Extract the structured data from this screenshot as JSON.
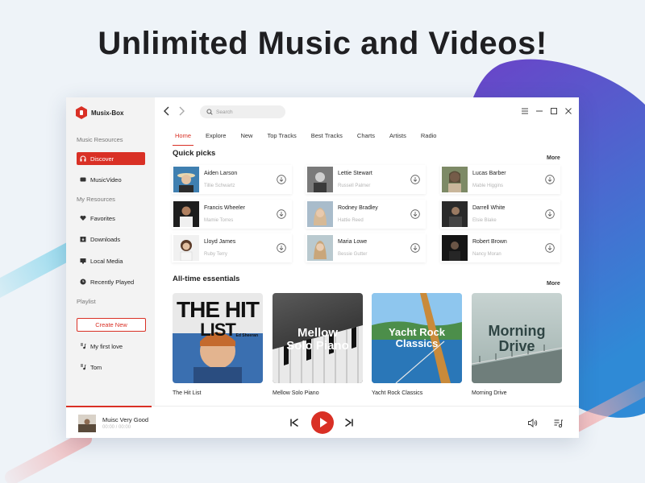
{
  "headline": "Unlimited Music and Videos!",
  "app": {
    "name": "Musix-Box"
  },
  "colors": {
    "accent": "#d93025",
    "blob_top": "#6e3fc7",
    "blob_bottom": "#2f7fd0"
  },
  "sidebar": {
    "music_resources_title": "Music Resources",
    "discover": "Discover",
    "music_video": "MusicVideo",
    "my_resources_title": "My Resources",
    "favorites": "Favorites",
    "downloads": "Downloads",
    "local_media": "Local Media",
    "recently_played": "Recently Played",
    "playlist_title": "Playlist",
    "create_new": "Create New",
    "playlists": [
      "My first love",
      "Tom"
    ]
  },
  "search": {
    "placeholder": "Search"
  },
  "tabs": [
    "Home",
    "Explore",
    "New",
    "Top Tracks",
    "Best Tracks",
    "Charts",
    "Artists",
    "Radio"
  ],
  "quick_picks": {
    "title": "Quick picks",
    "more": "More",
    "items": [
      {
        "title": "Aiden Larson",
        "subtitle": "Tillie Schwartz"
      },
      {
        "title": "Lettie Stewart",
        "subtitle": "Russell Palmer"
      },
      {
        "title": "Lucas Barber",
        "subtitle": "Mable Higgins"
      },
      {
        "title": "Francis Wheeler",
        "subtitle": "Mamie Torres"
      },
      {
        "title": "Rodney Bradley",
        "subtitle": "Hattie Reed"
      },
      {
        "title": "Darrell White",
        "subtitle": "Elsie Blake"
      },
      {
        "title": "Lloyd James",
        "subtitle": "Ruby Terry"
      },
      {
        "title": "Maria Lowe",
        "subtitle": "Bessie Gutter"
      },
      {
        "title": "Robert Brown",
        "subtitle": "Nancy Moran"
      }
    ]
  },
  "essentials": {
    "title": "All-time essentials",
    "more": "More",
    "items": [
      {
        "label": "The Hit List",
        "art_line1": "THE HIT",
        "art_line2": "LIST",
        "art_artist": "Ed Sheeran"
      },
      {
        "label": "Mellow Solo Piano",
        "art_line1": "Mellow",
        "art_line2": "Solo Piano"
      },
      {
        "label": "Yacht Rock Classics",
        "art_line1": "Yacht Rock",
        "art_line2": "Classics"
      },
      {
        "label": "Morning Drive",
        "art_line1": "Morning",
        "art_line2": "Drive"
      }
    ]
  },
  "player": {
    "title": "Muisc Very Good",
    "time": "00:00 / 00:00"
  }
}
